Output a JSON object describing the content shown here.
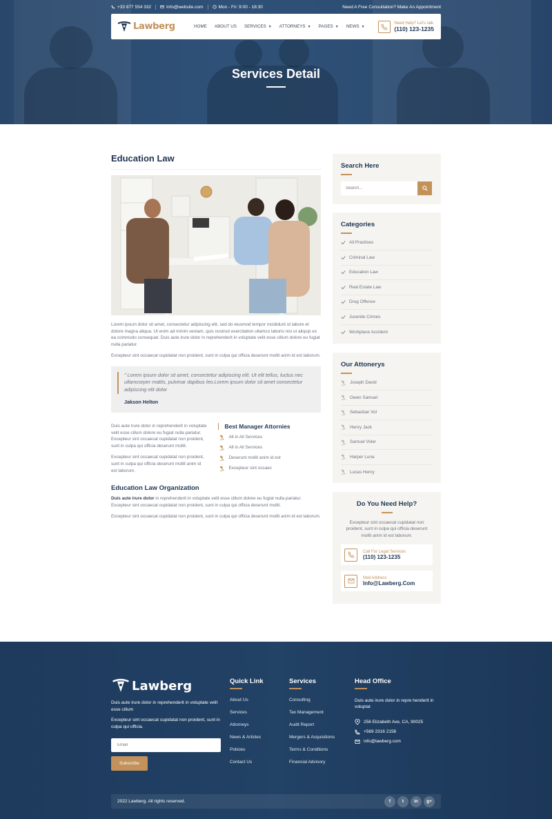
{
  "topbar": {
    "phone": "+33 877 554 332",
    "email": "Info@website.com",
    "hours": "Mon - Fri: 9:00 - 18:30",
    "cta": "Need A Free Consultation? Make An Appointment"
  },
  "brand": {
    "name": "Lawberg"
  },
  "nav": {
    "items": [
      "HOME",
      "ABOUT US",
      "SERVICES",
      "ATTORNEYS",
      "PAGES",
      "NEWS"
    ],
    "help_label": "Need Help? Let's talk",
    "help_phone": "(110) 123-1235"
  },
  "hero": {
    "title": "Services Detail"
  },
  "main": {
    "title": "Education Law",
    "para1": "Lorem ipsum dolor sit amet, consectetur adipiscing elit, sed do eiusmod tempor incididunt ut labore et dolore magna aliqua. Ut enim ad minim veniam, quis nostrud exercitation ullamco laboris nisi ut aliquip ex ea commodo consequat. Duis aute irure dolor in reprehenderit in voluptate velit esse cillum dolore eu fugiat nulla pariatur.",
    "para2": "Excepteur sint occaecat cupidatat non proident, sunt in culpa qui officia deserunt mollit anim id est laborum.",
    "quote": "\" Lorem ipsum dolor sit amet, consectetur adipiscing elit. Ut elit tellus, luctus nec ullamcorper mattis, pulvinar dapibus leo.Lorem ipsum dolor sit amet consectetur adipiscing elit dolor",
    "quote_author": "Jakson Helton",
    "col_para1": "Duis aute irure dolor in reprehenderit in voluptate velit esse cillum dolore eu fugiat nulla pariatur. Excepteur sint occaecat cupidatat non proident, sunt in culpa qui officia deserunt mollit.",
    "col_para2": "Excepteur sint occaecat cupidatat non proident, sunt in culpa qui officia deserunt mollit anim id est laborum.",
    "best_title": "Best Manager Attornies",
    "best_items": [
      "All in All Services",
      "All in All Services",
      "Deserunt mollit anim id est",
      "Excepteur sint occaec"
    ],
    "org_title": "Education Law Organization",
    "org_bold": "Duis aute irure dolor",
    "org_para1": " in reprehenderit in voluptate velit esse cillum dolore eu fugiat nulla pariatur. Excepteur sint occaecat cupidatat non proident, sunt in culpa qui officia deserunt mollit.",
    "org_para2": "Excepteur sint occaecat cupidatat non proident, sunt in culpa qui officia deserunt mollit anim id est laborum."
  },
  "sidebar": {
    "search_title": "Search Here",
    "search_placeholder": "Search...",
    "categories_title": "Categories",
    "categories": [
      "All Practises",
      "Criminal Law",
      "Education Law",
      "Real Estate Law",
      "Drug Offense",
      "Juvenile Crimes",
      "Workplace Accident"
    ],
    "attorneys_title": "Our Attonerys",
    "attorneys": [
      "Joseph David",
      "Owen Samuel",
      "Sebastian Vol",
      "Henry Jack",
      "Samuel Voler",
      "Harper Luna",
      "Lucas Henry"
    ],
    "help_title": "Do You Need Help?",
    "help_text": "Excepteur sint occaecat cupidatat non proident, sunt in culpa qui officia deserunt mollit anim id est laborum.",
    "call_label": "Call For Legal Services",
    "call_value": "(110) 123-1235",
    "mail_label": "Mail Address",
    "mail_value": "Info@Lawberg.Com"
  },
  "footer": {
    "about1": "Duis aute irure dolor in reprehenderit in voluptate velit esse cillum",
    "about2": "Excepteur sint occaecat cupidatat non proident, sunt in culpa qui officia.",
    "email_placeholder": "Email",
    "subscribe": "Subscribe",
    "quick_title": "Quick Link",
    "quick_links": [
      "About Us",
      "Services",
      "Attorneys",
      "News & Articles",
      "Policies",
      "Contact Us"
    ],
    "services_title": "Services",
    "services": [
      "Consulting",
      "Tax Management",
      "Audit Report",
      "Mergers & Acquisitions",
      "Terms & Conditions",
      "Financial Advisory"
    ],
    "office_title": "Head Office",
    "office_text": "Duis aute irure dolor in repre henderit in voluptat",
    "address": "256 Elizabeth Ave, CA, 90025",
    "phone": "+569 2316 2156",
    "email": "info@lawberg.com",
    "copyright": "2022 Lawberg. All rights reserved.",
    "socials": [
      "f",
      "t",
      "in",
      "g+"
    ]
  },
  "colors": {
    "accent": "#c3915a",
    "navy": "#1e3553",
    "hero": "#2f5178"
  }
}
